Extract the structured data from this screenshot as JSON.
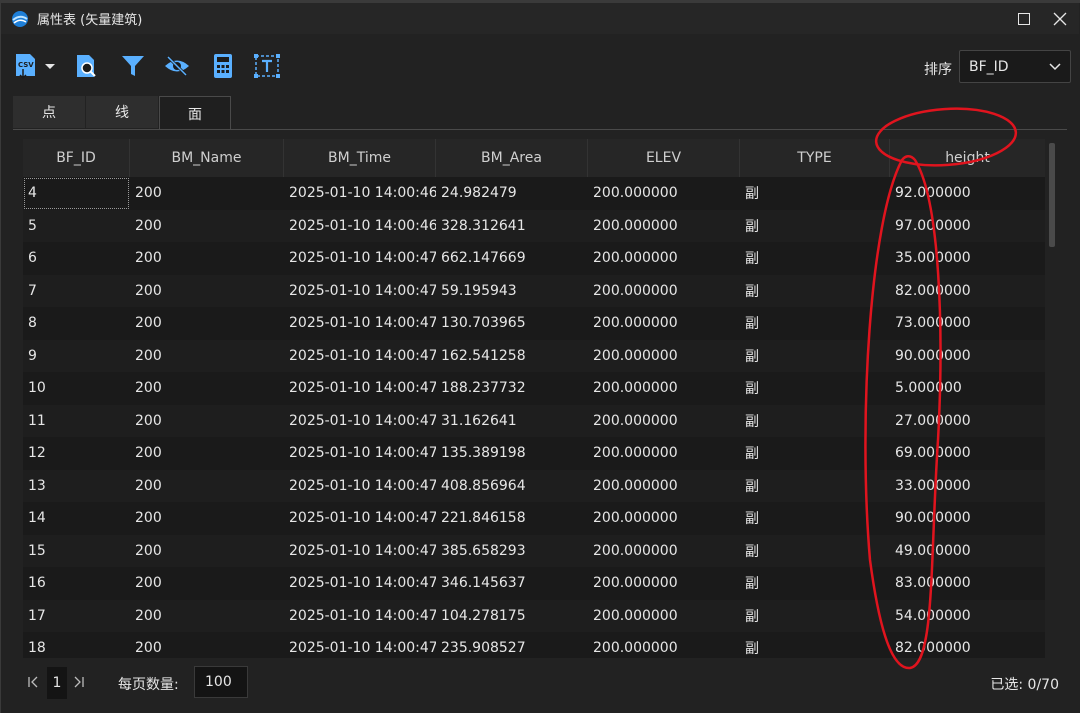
{
  "window": {
    "title": "属性表 (矢量建筑)"
  },
  "toolbar": {
    "sort_label": "排序",
    "sort_value": "BF_ID",
    "buttons": [
      "export-csv-icon",
      "search-document-icon",
      "filter-icon",
      "hide-eye-icon",
      "calculator-icon",
      "text-field-icon"
    ]
  },
  "tabs": [
    {
      "label": "点",
      "active": false
    },
    {
      "label": "线",
      "active": false
    },
    {
      "label": "面",
      "active": true
    }
  ],
  "table": {
    "columns": [
      "BF_ID",
      "BM_Name",
      "BM_Time",
      "BM_Area",
      "ELEV",
      "TYPE",
      "height"
    ],
    "rows": [
      [
        "4",
        "200",
        "2025-01-10 14:00:46",
        "24.982479",
        "200.000000",
        "副",
        "92.000000"
      ],
      [
        "5",
        "200",
        "2025-01-10 14:00:46",
        "328.312641",
        "200.000000",
        "副",
        "97.000000"
      ],
      [
        "6",
        "200",
        "2025-01-10 14:00:47",
        "662.147669",
        "200.000000",
        "副",
        "35.000000"
      ],
      [
        "7",
        "200",
        "2025-01-10 14:00:47",
        "59.195943",
        "200.000000",
        "副",
        "82.000000"
      ],
      [
        "8",
        "200",
        "2025-01-10 14:00:47",
        "130.703965",
        "200.000000",
        "副",
        "73.000000"
      ],
      [
        "9",
        "200",
        "2025-01-10 14:00:47",
        "162.541258",
        "200.000000",
        "副",
        "90.000000"
      ],
      [
        "10",
        "200",
        "2025-01-10 14:00:47",
        "188.237732",
        "200.000000",
        "副",
        "5.000000"
      ],
      [
        "11",
        "200",
        "2025-01-10 14:00:47",
        "31.162641",
        "200.000000",
        "副",
        "27.000000"
      ],
      [
        "12",
        "200",
        "2025-01-10 14:00:47",
        "135.389198",
        "200.000000",
        "副",
        "69.000000"
      ],
      [
        "13",
        "200",
        "2025-01-10 14:00:47",
        "408.856964",
        "200.000000",
        "副",
        "33.000000"
      ],
      [
        "14",
        "200",
        "2025-01-10 14:00:47",
        "221.846158",
        "200.000000",
        "副",
        "90.000000"
      ],
      [
        "15",
        "200",
        "2025-01-10 14:00:47",
        "385.658293",
        "200.000000",
        "副",
        "49.000000"
      ],
      [
        "16",
        "200",
        "2025-01-10 14:00:47",
        "346.145637",
        "200.000000",
        "副",
        "83.000000"
      ],
      [
        "17",
        "200",
        "2025-01-10 14:00:47",
        "104.278175",
        "200.000000",
        "副",
        "54.000000"
      ],
      [
        "18",
        "200",
        "2025-01-10 14:00:47",
        "235.908527",
        "200.000000",
        "副",
        "82.000000"
      ]
    ]
  },
  "footer": {
    "page_number": "1",
    "page_size_label": "每页数量:",
    "page_size_value": "100",
    "selected_info": "已选: 0/70"
  },
  "colors": {
    "background": "#222222",
    "annotation": "#e0141e",
    "icon_blue": "#5ab0ff"
  }
}
